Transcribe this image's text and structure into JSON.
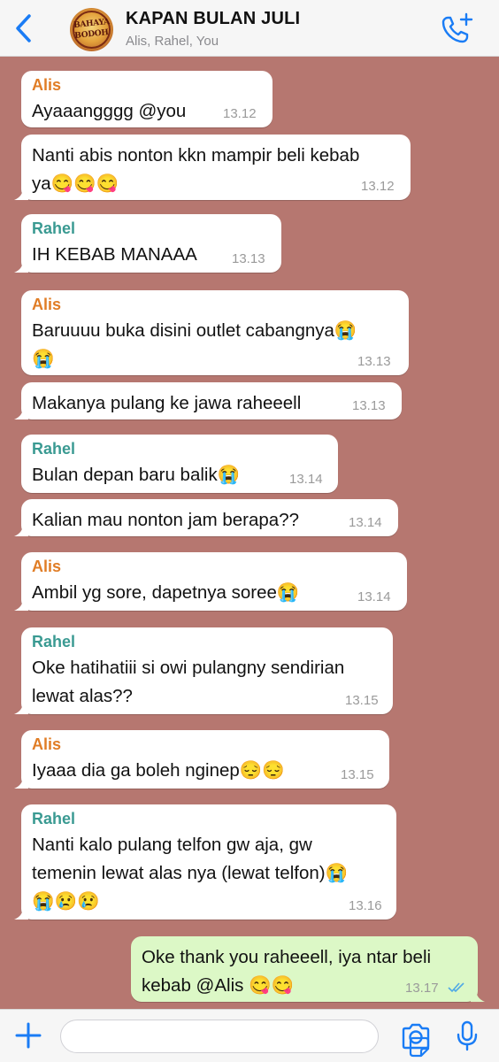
{
  "header": {
    "title": "KAPAN BULAN JULI",
    "participants": "Alis, Rahel, You",
    "avatar_text_line1": "BAHAYA",
    "avatar_text_line2": "BODOH"
  },
  "messages": [
    {
      "sender": "Alis",
      "lines": [
        "Ayaaangggg @you"
      ],
      "time": "13.12",
      "direction": "in"
    },
    {
      "sender": "",
      "lines": [
        "Nanti abis nonton kkn mampir beli kebab",
        "ya😋😋😋"
      ],
      "time": "13.12",
      "direction": "in"
    },
    {
      "sender": "Rahel",
      "lines": [
        "IH KEBAB MANAAA"
      ],
      "time": "13.13",
      "direction": "in"
    },
    {
      "sender": "Alis",
      "lines": [
        "Baruuuu buka disini outlet cabangnya😭",
        "😭"
      ],
      "time": "13.13",
      "direction": "in"
    },
    {
      "sender": "",
      "lines": [
        "Makanya pulang ke jawa raheeell"
      ],
      "time": "13.13",
      "direction": "in"
    },
    {
      "sender": "Rahel",
      "lines": [
        "Bulan depan baru balik😭"
      ],
      "time": "13.14",
      "direction": "in"
    },
    {
      "sender": "",
      "lines": [
        "Kalian mau nonton jam berapa??"
      ],
      "time": "13.14",
      "direction": "in"
    },
    {
      "sender": "Alis",
      "lines": [
        "Ambil yg sore, dapetnya soree😭"
      ],
      "time": "13.14",
      "direction": "in"
    },
    {
      "sender": "Rahel",
      "lines": [
        "Oke hatihatiii si owi pulangny sendirian",
        "lewat alas??"
      ],
      "time": "13.15",
      "direction": "in"
    },
    {
      "sender": "Alis",
      "lines": [
        "Iyaaa dia ga boleh nginep😔😔"
      ],
      "time": "13.15",
      "direction": "in"
    },
    {
      "sender": "Rahel",
      "lines": [
        "Nanti kalo pulang telfon gw aja, gw",
        "temenin lewat alas nya (lewat telfon)😭",
        "😭😢😢"
      ],
      "time": "13.16",
      "direction": "in"
    },
    {
      "sender": "",
      "lines": [
        "Oke thank you raheeell, iya ntar beli",
        "kebab @Alis 😋😋"
      ],
      "time": "13.17",
      "direction": "out",
      "status": "read"
    }
  ],
  "colors": {
    "chat_background": "#b67770",
    "accent_blue": "#1a7cf5",
    "alis_name": "#e07d26",
    "rahel_name": "#3a9a92",
    "outgoing_bubble": "#dcf8c6",
    "read_ticks": "#4fa9e6"
  },
  "icons": {
    "back": "chevron-left-icon",
    "call": "phone-add-icon",
    "attach": "plus-icon",
    "sticker": "sticker-icon",
    "camera": "camera-icon",
    "voice": "microphone-icon"
  }
}
